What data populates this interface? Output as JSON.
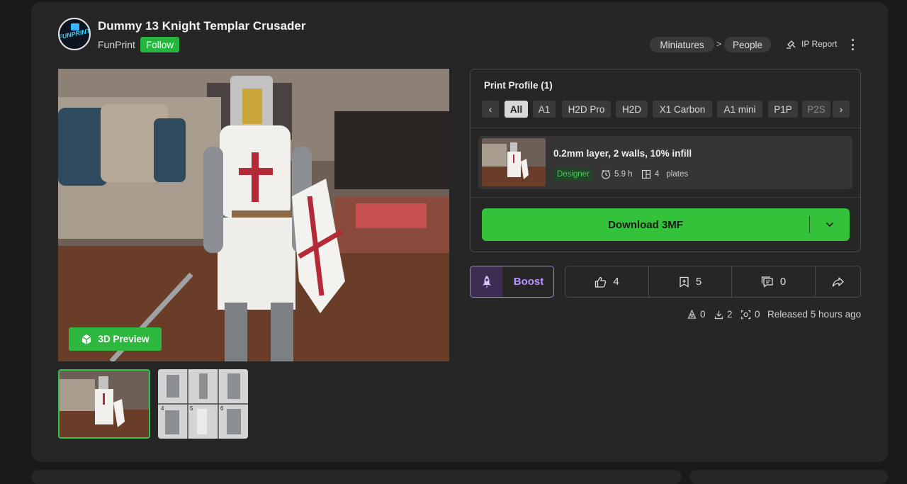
{
  "model": {
    "title": "Dummy 13 Knight Templar Crusader",
    "author": "FunPrint",
    "follow_label": "Follow",
    "avatar_text": "FUNPRINT"
  },
  "breadcrumb": {
    "category": "Miniatures",
    "separator": ">",
    "subcategory": "People"
  },
  "ip_report_label": "IP Report",
  "gallery": {
    "preview_label": "3D Preview",
    "thumb_numbers": [
      "4",
      "5",
      "6"
    ]
  },
  "print_profile": {
    "title": "Print Profile (1)",
    "printers": [
      "All",
      "A1",
      "H2D Pro",
      "H2D",
      "X1 Carbon",
      "A1 mini",
      "P1P",
      "P2S"
    ],
    "selected_printer": "All",
    "profile": {
      "name": "0.2mm layer, 2 walls, 10% infill",
      "badge": "Designer",
      "time": "5.9 h",
      "plates_count": "4",
      "plates_label": "plates"
    },
    "download_label": "Download 3MF"
  },
  "actions": {
    "boost_label": "Boost",
    "likes": "4",
    "collects": "5",
    "comments": "0"
  },
  "footer": {
    "prints": "0",
    "downloads": "2",
    "remixes": "0",
    "released": "Released 5 hours ago"
  },
  "colors": {
    "accent_green": "#33c23a",
    "boost_purple": "#b994ff",
    "background": "#1a1a1a",
    "card": "#262626"
  }
}
